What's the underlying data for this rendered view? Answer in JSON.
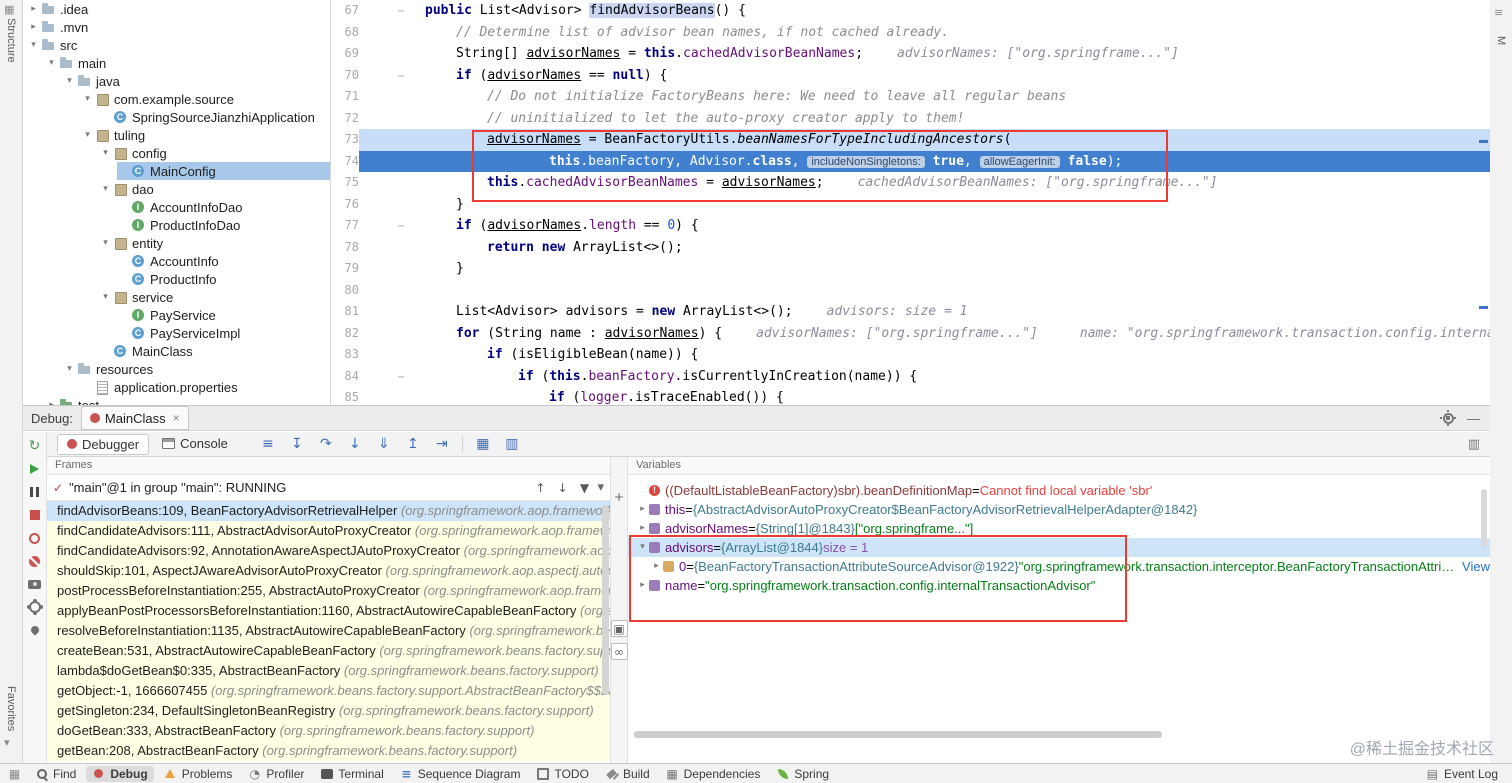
{
  "window": {
    "watermark": "@稀土掘金技术社区"
  },
  "left_strip": {
    "top": "Structure",
    "bottom": "Favorites"
  },
  "right_strip": {
    "label": "M"
  },
  "project_tree": {
    "items": [
      {
        "label": ".idea",
        "indent": 1,
        "chevron": "closed",
        "icon": "folder"
      },
      {
        "label": ".mvn",
        "indent": 1,
        "chevron": "closed",
        "icon": "folder"
      },
      {
        "label": "src",
        "indent": 1,
        "chevron": "open",
        "icon": "folder"
      },
      {
        "label": "main",
        "indent": 2,
        "chevron": "open",
        "icon": "folder"
      },
      {
        "label": "java",
        "indent": 3,
        "chevron": "open",
        "icon": "folder"
      },
      {
        "label": "com.example.source",
        "indent": 4,
        "chevron": "open",
        "icon": "package"
      },
      {
        "label": "SpringSourceJianzhiApplication",
        "indent": 5,
        "chevron": "none",
        "icon": "class"
      },
      {
        "label": "tuling",
        "indent": 4,
        "chevron": "open",
        "icon": "package"
      },
      {
        "label": "config",
        "indent": 5,
        "chevron": "open",
        "icon": "package"
      },
      {
        "label": "MainConfig",
        "indent": 6,
        "chevron": "none",
        "icon": "class",
        "selected": true
      },
      {
        "label": "dao",
        "indent": 5,
        "chevron": "open",
        "icon": "package"
      },
      {
        "label": "AccountInfoDao",
        "indent": 6,
        "chevron": "none",
        "icon": "interface"
      },
      {
        "label": "ProductInfoDao",
        "indent": 6,
        "chevron": "none",
        "icon": "interface"
      },
      {
        "label": "entity",
        "indent": 5,
        "chevron": "open",
        "icon": "package"
      },
      {
        "label": "AccountInfo",
        "indent": 6,
        "chevron": "none",
        "icon": "class"
      },
      {
        "label": "ProductInfo",
        "indent": 6,
        "chevron": "none",
        "icon": "class"
      },
      {
        "label": "service",
        "indent": 5,
        "chevron": "open",
        "icon": "package"
      },
      {
        "label": "PayService",
        "indent": 6,
        "chevron": "none",
        "icon": "interface"
      },
      {
        "label": "PayServiceImpl",
        "indent": 6,
        "chevron": "none",
        "icon": "class"
      },
      {
        "label": "MainClass",
        "indent": 5,
        "chevron": "none",
        "icon": "class"
      },
      {
        "label": "resources",
        "indent": 3,
        "chevron": "open",
        "icon": "folder"
      },
      {
        "label": "application.properties",
        "indent": 4,
        "chevron": "none",
        "icon": "file"
      },
      {
        "label": "test",
        "indent": 2,
        "chevron": "closed",
        "icon": "folder-test"
      }
    ]
  },
  "editor": {
    "lines": [
      {
        "n": 67,
        "ind": 1,
        "fold": true,
        "seg": [
          [
            "k",
            "public "
          ],
          [
            "p",
            "List<Advisor> "
          ],
          [
            "hl",
            "findAdvisorBeans"
          ],
          [
            "p",
            "() {"
          ]
        ]
      },
      {
        "n": 68,
        "ind": 2,
        "seg": [
          [
            "c",
            "// Determine list of advisor bean names, if not cached already."
          ]
        ]
      },
      {
        "n": 69,
        "ind": 2,
        "seg": [
          [
            "p",
            "String[] "
          ],
          [
            "u",
            "advisorNames"
          ],
          [
            "p",
            " = "
          ],
          [
            "k",
            "this"
          ],
          [
            "p",
            "."
          ],
          [
            "f",
            "cachedAdvisorBeanNames"
          ],
          [
            "p",
            ";"
          ]
        ],
        "hint": "advisorNames: [\"org.springframe...\"]"
      },
      {
        "n": 70,
        "ind": 2,
        "fold": true,
        "seg": [
          [
            "k",
            "if"
          ],
          [
            "p",
            " ("
          ],
          [
            "u",
            "advisorNames"
          ],
          [
            "p",
            " == "
          ],
          [
            "k",
            "null"
          ],
          [
            "p",
            ") {"
          ]
        ]
      },
      {
        "n": 71,
        "ind": 3,
        "seg": [
          [
            "c",
            "// Do not initialize FactoryBeans here: We need to leave all regular beans"
          ]
        ]
      },
      {
        "n": 72,
        "ind": 3,
        "seg": [
          [
            "c",
            "// uninitialized to let the auto-proxy creator apply to them!"
          ]
        ]
      },
      {
        "n": 73,
        "ind": 3,
        "bg": "sel",
        "seg": [
          [
            "u",
            "advisorNames"
          ],
          [
            "p",
            " = BeanFactoryUtils."
          ],
          [
            "sm",
            "beanNamesForTypeIncludingAncestors"
          ],
          [
            "p",
            "("
          ]
        ]
      },
      {
        "n": 74,
        "ind": 5,
        "bg": "exec",
        "seg": [
          [
            "k",
            "this"
          ],
          [
            "p",
            "."
          ],
          [
            "f",
            "beanFactory"
          ],
          [
            "p",
            ", Advisor."
          ],
          [
            "k",
            "class"
          ],
          [
            "p",
            ", "
          ],
          [
            "bdg",
            "includeNonSingletons:"
          ],
          [
            "p",
            " "
          ],
          [
            "k",
            "true"
          ],
          [
            "p",
            ", "
          ],
          [
            "bdg",
            "allowEagerInit:"
          ],
          [
            "p",
            " "
          ],
          [
            "k",
            "false"
          ],
          [
            "p",
            ");"
          ]
        ]
      },
      {
        "n": 75,
        "ind": 3,
        "seg": [
          [
            "k",
            "this"
          ],
          [
            "p",
            "."
          ],
          [
            "f",
            "cachedAdvisorBeanNames"
          ],
          [
            "p",
            " = "
          ],
          [
            "u",
            "advisorNames"
          ],
          [
            "p",
            ";"
          ]
        ],
        "hint": "cachedAdvisorBeanNames: [\"org.springframe...\"]"
      },
      {
        "n": 76,
        "ind": 2,
        "seg": [
          [
            "p",
            "}"
          ]
        ]
      },
      {
        "n": 77,
        "ind": 2,
        "fold": true,
        "seg": [
          [
            "k",
            "if"
          ],
          [
            "p",
            " ("
          ],
          [
            "u",
            "advisorNames"
          ],
          [
            "p",
            "."
          ],
          [
            "f",
            "length"
          ],
          [
            "p",
            " == "
          ],
          [
            "num",
            "0"
          ],
          [
            "p",
            ") {"
          ]
        ]
      },
      {
        "n": 78,
        "ind": 3,
        "seg": [
          [
            "k",
            "return new "
          ],
          [
            "p",
            "ArrayList<>();"
          ]
        ]
      },
      {
        "n": 79,
        "ind": 2,
        "seg": [
          [
            "p",
            "}"
          ]
        ]
      },
      {
        "n": 80,
        "ind": 0,
        "seg": []
      },
      {
        "n": 81,
        "ind": 2,
        "seg": [
          [
            "p",
            "List<Advisor> advisors = "
          ],
          [
            "k",
            "new"
          ],
          [
            "p",
            " ArrayList<>();"
          ]
        ],
        "hint": "advisors:  size = 1"
      },
      {
        "n": 82,
        "ind": 2,
        "seg": [
          [
            "k",
            "for"
          ],
          [
            "p",
            " (String name : "
          ],
          [
            "u",
            "advisorNames"
          ],
          [
            "p",
            ") {"
          ]
        ],
        "hint": "advisorNames: [\"org.springframe...\"]",
        "hint2": "name: \"org.springframework.transaction.config.internalTransactionAdv"
      },
      {
        "n": 83,
        "ind": 3,
        "seg": [
          [
            "k",
            "if"
          ],
          [
            "p",
            " ("
          ],
          [
            "p",
            "isEligibleBean(name)) {"
          ]
        ]
      },
      {
        "n": 84,
        "ind": 4,
        "fold": true,
        "seg": [
          [
            "k",
            "if"
          ],
          [
            "p",
            " ("
          ],
          [
            "k",
            "this"
          ],
          [
            "p",
            "."
          ],
          [
            "f",
            "beanFactory"
          ],
          [
            "p",
            ".isCurrentlyInCreation(name)) {"
          ]
        ]
      },
      {
        "n": 85,
        "ind": 5,
        "seg": [
          [
            "k",
            "if"
          ],
          [
            "p",
            " ("
          ],
          [
            "f",
            "logger"
          ],
          [
            "p",
            ".isTraceEnabled()) {"
          ]
        ]
      }
    ]
  },
  "debug": {
    "header_label": "Debug:",
    "session_tab": "MainClass",
    "tabs": [
      {
        "label": "Debugger",
        "icon": "bug",
        "selected": true
      },
      {
        "label": "Console",
        "icon": "console",
        "selected": false
      }
    ],
    "step_toolbar": [
      "hamburger",
      "show-execution-point",
      "step-over",
      "step-into",
      "force-step-into",
      "step-out",
      "run-to-cursor",
      "sep",
      "view-grid",
      "layout-grid"
    ],
    "left_toolbar": [
      "rerun",
      "resume",
      "pause",
      "stop",
      "view-breakpoints",
      "mute-breakpoints",
      "thread-dump",
      "settings",
      "pin"
    ],
    "watch_strip": [
      "add-watch",
      "panel-grid",
      "evaluate-inline"
    ],
    "frames": {
      "title": "Frames",
      "thread": "\"main\"@1 in group \"main\": RUNNING",
      "toolbar": [
        "frame-up",
        "frame-down",
        "filter"
      ],
      "rows": [
        {
          "method": "findAdvisorBeans:109, BeanFactoryAdvisorRetrievalHelper ",
          "pkg": "(org.springframework.aop.framework.au",
          "selected": true
        },
        {
          "method": "findCandidateAdvisors:111, AbstractAdvisorAutoProxyCreator ",
          "pkg": "(org.springframework.aop.framewor"
        },
        {
          "method": "findCandidateAdvisors:92, AnnotationAwareAspectJAutoProxyCreator ",
          "pkg": "(org.springframework.aop.as"
        },
        {
          "method": "shouldSkip:101, AspectJAwareAdvisorAutoProxyCreator ",
          "pkg": "(org.springframework.aop.aspectj.autopro..."
        },
        {
          "method": "postProcessBeforeInstantiation:255, AbstractAutoProxyCreator ",
          "pkg": "(org.springframework.aop.framewo..."
        },
        {
          "method": "applyBeanPostProcessorsBeforeInstantiation:1160, AbstractAutowireCapableBeanFactory ",
          "pkg": "(org.spri..."
        },
        {
          "method": "resolveBeforeInstantiation:1135, AbstractAutowireCapableBeanFactory ",
          "pkg": "(org.springframework.bean..."
        },
        {
          "method": "createBean:531, AbstractAutowireCapableBeanFactory ",
          "pkg": "(org.springframework.beans.factory.suppor..."
        },
        {
          "method": "lambda$doGetBean$0:335, AbstractBeanFactory ",
          "pkg": "(org.springframework.beans.factory.support)"
        },
        {
          "method": "getObject:-1, 1666607455 ",
          "pkg": "(org.springframework.beans.factory.support.AbstractBeanFactory$$La..."
        },
        {
          "method": "getSingleton:234, DefaultSingletonBeanRegistry ",
          "pkg": "(org.springframework.beans.factory.support)"
        },
        {
          "method": "doGetBean:333, AbstractBeanFactory ",
          "pkg": "(org.springframework.beans.factory.support)"
        },
        {
          "method": "getBean:208, AbstractBeanFactory ",
          "pkg": "(org.springframework.beans.factory.support)"
        }
      ]
    },
    "variables": {
      "title": "Variables",
      "rows": [
        {
          "kind": "error",
          "expr": "((DefaultListableBeanFactory)sbr).beanDefinitionMap",
          "error": "Cannot find local variable 'sbr'"
        },
        {
          "kind": "obj",
          "chev": "closed",
          "name": "this",
          "ref": "{AbstractAdvisorAutoProxyCreator$BeanFactoryAdvisorRetrievalHelperAdapter@1842}"
        },
        {
          "kind": "obj",
          "chev": "closed",
          "name": "advisorNames",
          "ref": "{String[1]@1843} ",
          "preview": "[\"org.springframe...\"]"
        },
        {
          "kind": "obj",
          "chev": "open",
          "name": "advisors",
          "ref": "{ArrayList@1844} ",
          "size": " size = 1",
          "selected": true
        },
        {
          "kind": "elem",
          "chev": "closed",
          "name": "0",
          "ref": "{BeanFactoryTransactionAttributeSourceAdvisor@1922} ",
          "str": "\"org.springframework.transaction.interceptor.BeanFactoryTransactionAttribute...",
          "link": "View",
          "indent": 1
        },
        {
          "kind": "obj",
          "chev": "closed",
          "name": "name",
          "str": "\"org.springframework.transaction.config.internalTransactionAdvisor\""
        }
      ]
    }
  },
  "status_bar": {
    "items": [
      {
        "label": "Find",
        "icon": "find"
      },
      {
        "label": "Debug",
        "icon": "debug",
        "active": true
      },
      {
        "label": "Problems",
        "icon": "problems"
      },
      {
        "label": "Profiler",
        "icon": "profiler"
      },
      {
        "label": "Terminal",
        "icon": "terminal"
      },
      {
        "label": "Sequence Diagram",
        "icon": "sequence"
      },
      {
        "label": "TODO",
        "icon": "todo"
      },
      {
        "label": "Build",
        "icon": "build"
      },
      {
        "label": "Dependencies",
        "icon": "dependencies"
      },
      {
        "label": "Spring",
        "icon": "spring"
      }
    ],
    "right": {
      "label": "Event Log",
      "icon": "event-log"
    }
  }
}
